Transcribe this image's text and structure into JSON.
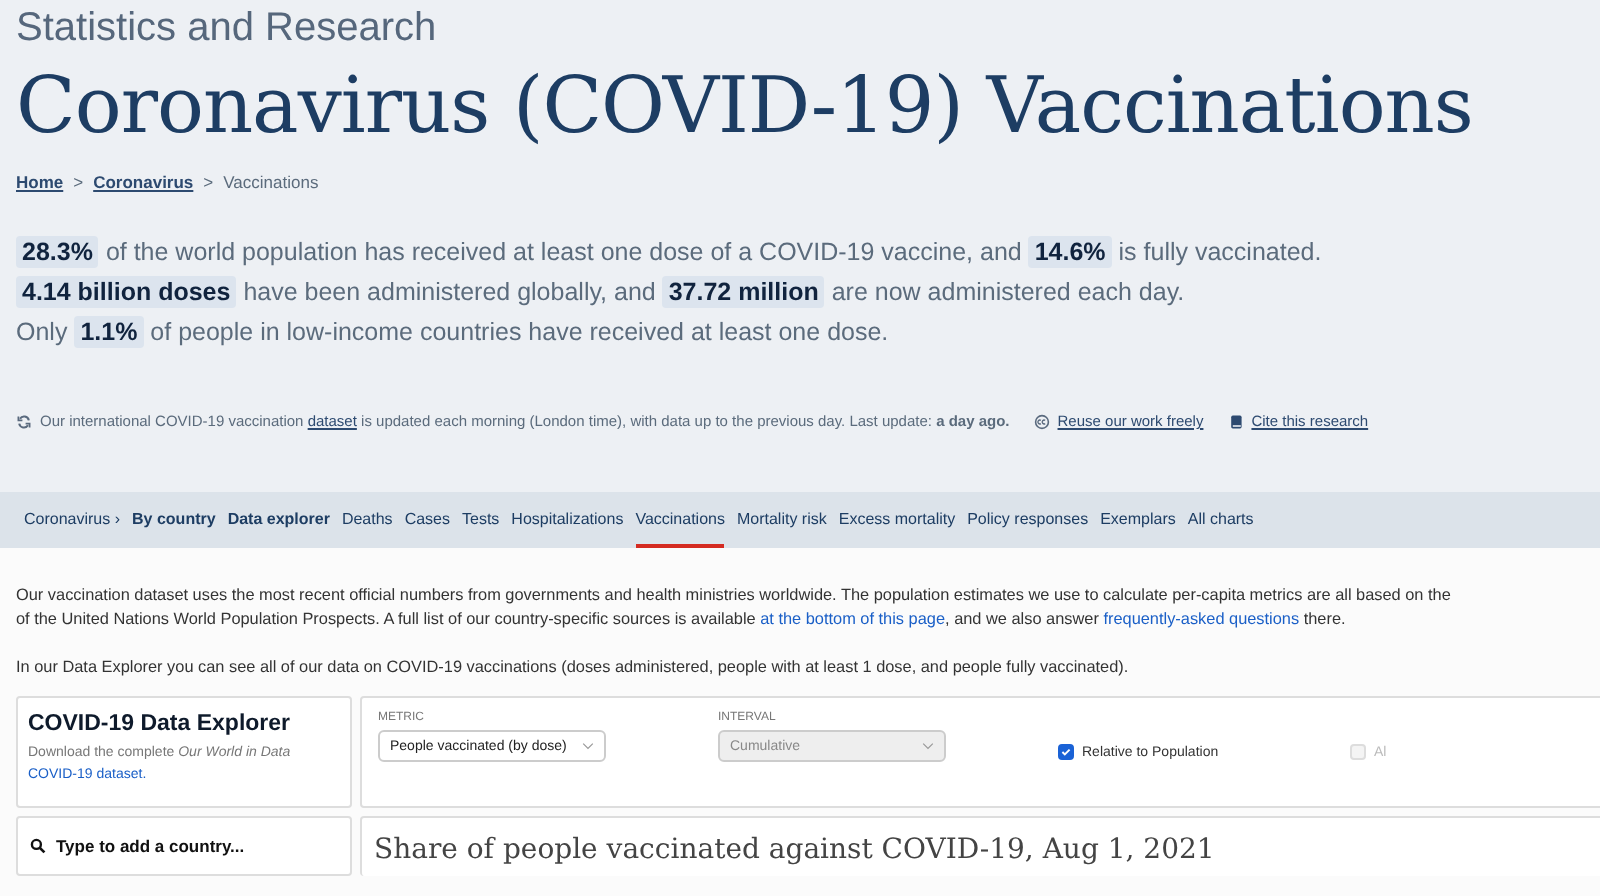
{
  "header": {
    "kicker": "Statistics and Research",
    "title": "Coronavirus (COVID-19) Vaccinations"
  },
  "breadcrumb": [
    {
      "label": "Home",
      "link": true
    },
    {
      "label": "Coronavirus",
      "link": true
    },
    {
      "label": "Vaccinations",
      "link": false
    }
  ],
  "breadcrumb_separator": ">",
  "highlights": [
    [
      {
        "text": "28.3%",
        "kind": "value"
      },
      {
        "text": "of the world population has received at least one dose of a COVID-19 vaccine, and",
        "kind": "text"
      },
      {
        "text": "14.6%",
        "kind": "value"
      },
      {
        "text": "is fully vaccinated.",
        "kind": "text"
      }
    ],
    [
      {
        "text": "4.14 billion doses",
        "kind": "value"
      },
      {
        "text": "have been administered globally, and",
        "kind": "text"
      },
      {
        "text": "37.72 million",
        "kind": "value"
      },
      {
        "text": "are now administered each day.",
        "kind": "text"
      }
    ],
    [
      {
        "text": "Only",
        "kind": "text"
      },
      {
        "text": "1.1%",
        "kind": "value"
      },
      {
        "text": "of people in low-income countries have received at least one dose.",
        "kind": "text"
      }
    ]
  ],
  "update_note": {
    "before": "Our international COVID-19 vaccination",
    "link": "dataset",
    "after": "is updated each morning (London time), with data up to the previous day. Last update: **a day ago.**"
  },
  "meta_links": [
    {
      "label": "Reuse our work freely",
      "kind": "reuse"
    },
    {
      "label": "Cite this research",
      "kind": "cite"
    }
  ],
  "nav": [
    {
      "label": "Coronavirus ›",
      "bold": false,
      "selected": false
    },
    {
      "label": "By country",
      "bold": true,
      "selected": false
    },
    {
      "label": "Data explorer",
      "bold": true,
      "selected": false
    },
    {
      "label": "Deaths",
      "bold": false,
      "selected": false
    },
    {
      "label": "Cases",
      "bold": false,
      "selected": false
    },
    {
      "label": "Tests",
      "bold": false,
      "selected": false
    },
    {
      "label": "Hospitalizations",
      "bold": false,
      "selected": false
    },
    {
      "label": "Vaccinations",
      "bold": false,
      "selected": true
    },
    {
      "label": "Mortality risk",
      "bold": false,
      "selected": false
    },
    {
      "label": "Excess mortality",
      "bold": false,
      "selected": false
    },
    {
      "label": "Policy responses",
      "bold": false,
      "selected": false
    },
    {
      "label": "Exemplars",
      "bold": false,
      "selected": false
    },
    {
      "label": "All charts",
      "bold": false,
      "selected": false
    }
  ],
  "intro": {
    "line1": "Our vaccination dataset uses the most recent official numbers from governments and health ministries worldwide. The population estimates we use to calculate per-capita metrics are all based on the",
    "line2_before": "of the United Nations World Population Prospects. A full list of our country-specific sources is available",
    "link1": "at the bottom of this page",
    "line2_middle": ", and we also answer",
    "link2": "frequently-asked questions",
    "line2_after": "there."
  },
  "explorer_note": "In our Data Explorer you can see all of our data on COVID-19 vaccinations (doses administered, people with at least 1 dose, and people fully vaccinated).",
  "explorer": {
    "title": "COVID-19 Data Explorer",
    "description": "Download the complete",
    "description_italic": "Our World in Data",
    "link": "COVID-19 dataset.",
    "search_placeholder": "Type to add a country..."
  },
  "controls": {
    "metric": {
      "label": "METRIC",
      "value": "People vaccinated (by dose)",
      "disabled": false
    },
    "interval": {
      "label": "INTERVAL",
      "value": "Cumulative",
      "disabled": true
    },
    "checkboxes": [
      {
        "label": "Relative to Population",
        "checked": true,
        "disabled": false
      },
      {
        "label": "Al",
        "checked": false,
        "disabled": true
      }
    ]
  },
  "chart_title": "Share of people vaccinated against COVID-19, Aug 1, 2021"
}
